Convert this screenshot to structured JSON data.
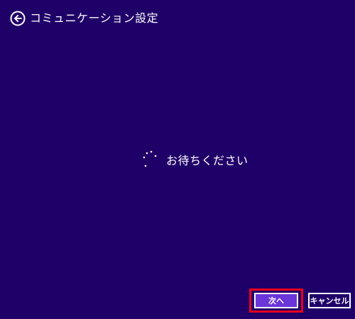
{
  "header": {
    "back_icon": "back-arrow-circle-icon",
    "title": "コミュニケーション設定"
  },
  "loading": {
    "spinner_icon": "loading-spinner-icon",
    "message": "お待ちください"
  },
  "footer": {
    "next_label": "次へ",
    "cancel_label": "キャンセル"
  },
  "colors": {
    "background": "#1f0068",
    "next_button": "#6a35d9",
    "highlight": "#e8001e",
    "text": "#ffffff"
  }
}
